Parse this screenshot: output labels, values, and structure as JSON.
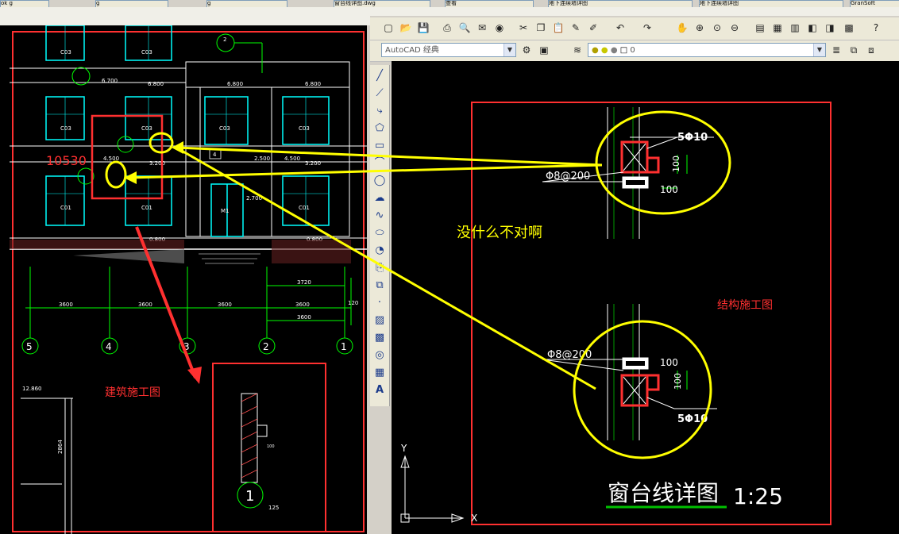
{
  "taskbar": {
    "tabs": [
      "ok g",
      "g",
      "g",
      "窗台线详图.dwg",
      "查看",
      "地下连续墙详图",
      "GranSoft"
    ]
  },
  "toolbars": {
    "workspace_value": "AutoCAD 经典",
    "layer_value": "0"
  },
  "left_drawing": {
    "window_labels": [
      "C03",
      "C03",
      "C03",
      "C03",
      "C03",
      "C03",
      "C01",
      "C01",
      "C01",
      "C01",
      "C01"
    ],
    "door_label": "M1",
    "door_marker": "4",
    "dims": {
      "d6700": "6.700",
      "d6800a": "6.800",
      "d6800b": "6.800",
      "d6800c": "6.800",
      "d4500": "4.500",
      "d3200a": "3.200",
      "d4500b": "4.500",
      "d3200b": "3.200",
      "d2500": "2.500",
      "d2700": "2.700",
      "d0800a": "0.800",
      "d0800b": "0.800",
      "d3720": "3720",
      "d3600a": "3600",
      "d3600b": "3600",
      "d3600c": "3600",
      "d3600d": "3600",
      "d3600e": "3600",
      "d120": "120",
      "d12860": "12.860",
      "d2864": "2864",
      "d125": "125",
      "d100": "100"
    },
    "marker_two": "2",
    "red_number": "10530",
    "axis_labels": [
      "5",
      "4",
      "3",
      "2",
      "1"
    ],
    "section_number": "1",
    "caption_arch": "建筑施工图"
  },
  "right_drawing": {
    "top_detail": {
      "rebar": "5Φ10",
      "stirrup": "Φ8@200",
      "dim_a": "100",
      "dim_b": "100"
    },
    "bottom_detail": {
      "rebar": "5Φ10",
      "stirrup": "Φ8@200",
      "dim_a": "100",
      "dim_b": "100"
    },
    "comment": "没什么不对啊",
    "caption_struct": "结构施工图",
    "detail_title": "窗台线详图",
    "detail_scale": "1:25",
    "ucs_y": "Y",
    "ucs_x": "X"
  },
  "colors": {
    "cad_background": "#000000",
    "highlight_red": "#ff3030",
    "annotation_yellow": "#ffff00",
    "dimension_green": "#00ff00",
    "window_cyan": "#00ffff",
    "underline_green": "#00c000"
  }
}
